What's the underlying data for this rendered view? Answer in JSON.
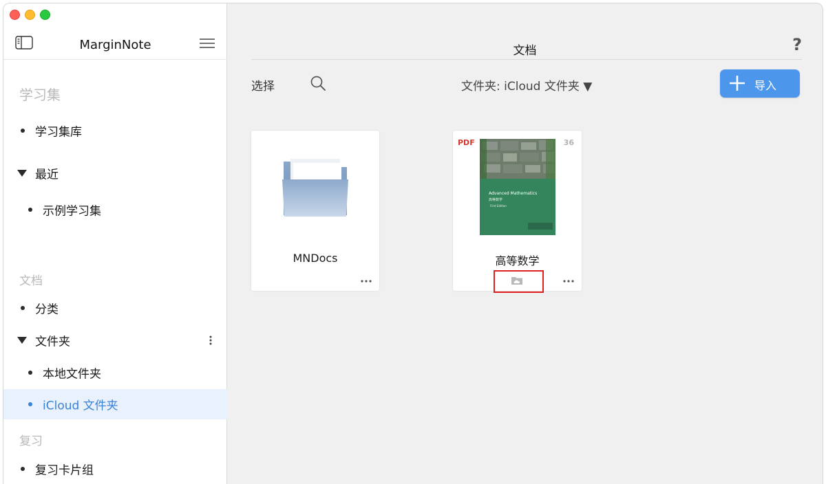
{
  "app": {
    "title": "MarginNote"
  },
  "sidebar": {
    "sections": [
      {
        "label": "学习集"
      },
      {
        "label": "文档"
      },
      {
        "label": "复习"
      }
    ],
    "items": [
      {
        "label": "学习集库"
      },
      {
        "label": "最近"
      },
      {
        "label": "示例学习集"
      },
      {
        "label": "分类"
      },
      {
        "label": "文件夹"
      },
      {
        "label": "本地文件夹"
      },
      {
        "label": "iCloud 文件夹"
      },
      {
        "label": "复习卡片组"
      }
    ],
    "selected_item": "iCloud 文件夹"
  },
  "main": {
    "title": "文档",
    "help_label": "?",
    "toolbar": {
      "select_label": "选择",
      "folder_picker": "文件夹: iCloud 文件夹 ▼",
      "import_label": "导入"
    },
    "cards": [
      {
        "name": "MNDocs",
        "type": "folder"
      },
      {
        "name": "高等数学",
        "type": "pdf",
        "badge": "PDF",
        "pages": "36",
        "cover_title": "Advanced Mathematics",
        "cover_subtitle": "高等数学",
        "cover_edition": "First Edition"
      }
    ]
  },
  "colors": {
    "accent": "#4c97ec",
    "selected_bg": "#e9f1fc",
    "highlight_box": "#e01f1f",
    "pdf_badge": "#d0372d"
  },
  "icons": [
    "sidebar-toggle-icon",
    "menu-icon",
    "kebab-icon",
    "help-icon",
    "search-icon",
    "plus-icon",
    "folder-icon",
    "cloud-folder-icon",
    "more-icon"
  ]
}
